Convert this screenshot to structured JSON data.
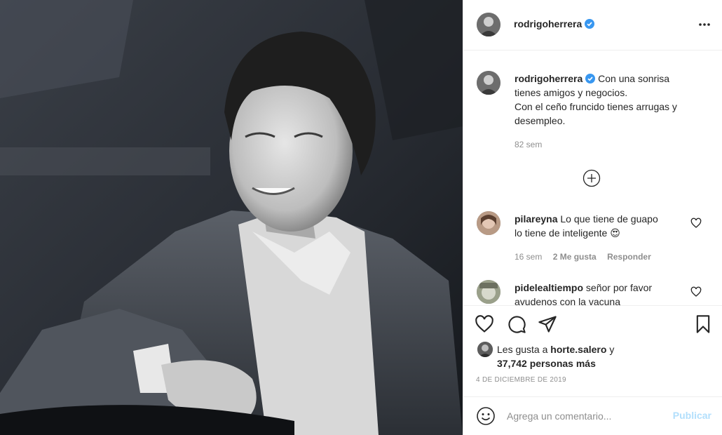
{
  "post": {
    "author": "rodrigoherrera",
    "verified": true,
    "caption_lines": [
      "Con una sonrisa",
      "tienes amigos y negocios.",
      "Con el ceño fruncido tienes arrugas y",
      "desempleo."
    ],
    "caption_age": "82 sem",
    "date": "4 DE DICIEMBRE DE 2019"
  },
  "icons": {
    "more": "more-horizontal-icon",
    "verified": "verified-badge-icon",
    "load_more": "plus-circle-icon",
    "like": "heart-icon",
    "comment": "comment-icon",
    "share": "paper-plane-icon",
    "save": "bookmark-icon",
    "emoji": "smiley-icon"
  },
  "comments": [
    {
      "user": "pilareyna",
      "text_lines": [
        "Lo que tiene de guapo",
        "lo tiene de inteligente 😍"
      ],
      "age": "16 sem",
      "likes": "2 Me gusta",
      "reply": "Responder"
    },
    {
      "user": "pidelealtiempo",
      "text_lines": [
        "señor por favor",
        "ayudenos con la vacuna"
      ]
    }
  ],
  "likes": {
    "prefix": "Les gusta a",
    "user": "horte.salero",
    "connector": "y",
    "count_text": "37,742 personas más"
  },
  "composer": {
    "placeholder": "Agrega un comentario...",
    "publish_label": "Publicar"
  },
  "colors": {
    "verified_blue": "#3897f0",
    "publish_disabled": "#b2dffc",
    "secondary_text": "#8e8e8e"
  }
}
